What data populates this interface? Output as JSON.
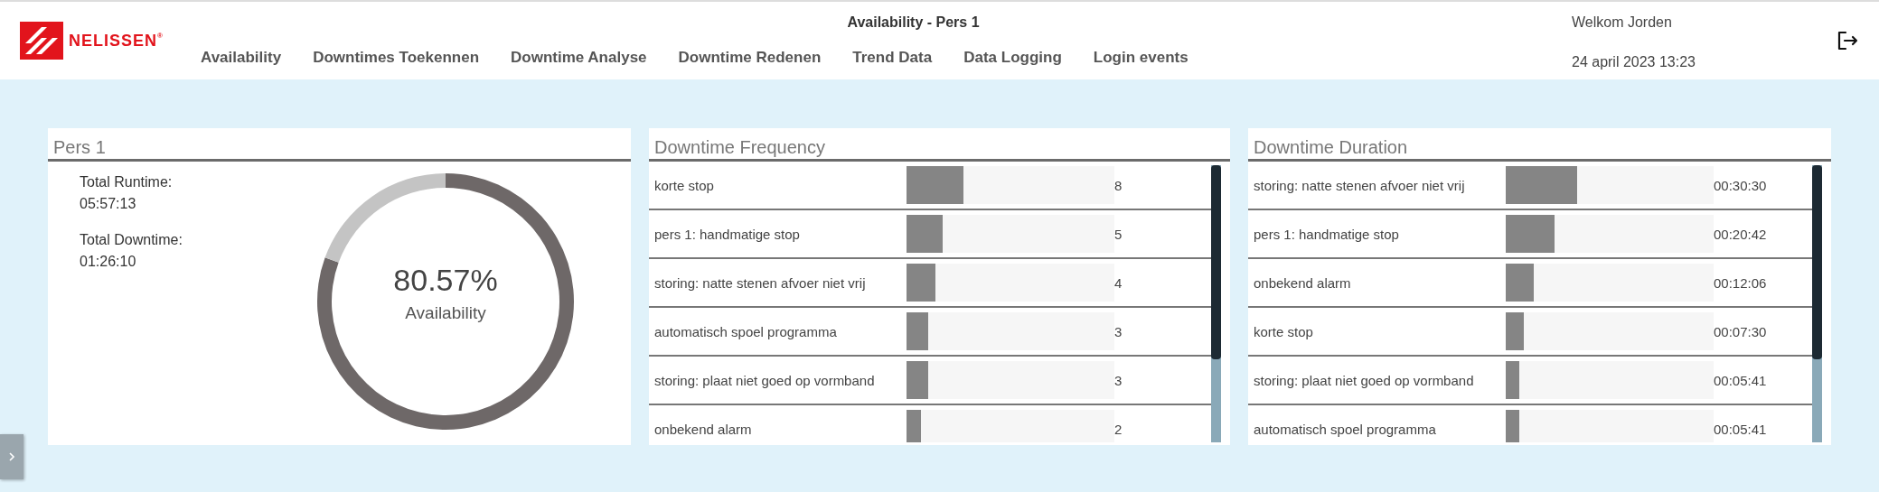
{
  "header": {
    "logo": {
      "text": "NELISSEN",
      "mark": "®"
    },
    "title": "Availability - Pers 1",
    "nav": [
      {
        "label": "Availability",
        "selected": false
      },
      {
        "label": "Downtimes Toekennen",
        "selected": false
      },
      {
        "label": "Downtime Analyse",
        "selected": false
      },
      {
        "label": "Downtime Redenen",
        "selected": false
      },
      {
        "label": "Trend Data",
        "selected": false
      },
      {
        "label": "Data Logging",
        "selected": false
      },
      {
        "label": "Login events",
        "selected": false
      }
    ],
    "welcome": "Welkom Jorden",
    "datetime": "24 april 2023 13:23"
  },
  "availability_panel": {
    "title": "Pers 1",
    "stats": [
      {
        "label": "Total Runtime:",
        "value": "05:57:13"
      },
      {
        "label": "Total Downtime:",
        "value": "01:26:10"
      }
    ],
    "gauge": {
      "value": "80.57%",
      "label": "Availability",
      "chart_data": {
        "type": "donut",
        "values": [
          80.57,
          19.43
        ]
      }
    }
  },
  "frequency_panel": {
    "title": "Downtime Frequency",
    "rows": [
      {
        "label": "korte stop",
        "level": 0.274,
        "value": "8"
      },
      {
        "label": "pers 1: handmatige stop",
        "level": 0.172,
        "value": "5"
      },
      {
        "label": "storing: natte stenen afvoer niet vrij",
        "level": 0.137,
        "value": "4"
      },
      {
        "label": "automatisch spoel programma",
        "level": 0.103,
        "value": "3"
      },
      {
        "label": "storing: plaat niet goed op vormband",
        "level": 0.103,
        "value": "3"
      },
      {
        "label": "onbekend alarm",
        "level": 0.069,
        "value": "2"
      }
    ]
  },
  "duration_panel": {
    "title": "Downtime Duration",
    "rows": [
      {
        "label": "storing: natte stenen afvoer niet vrij",
        "level": 0.343,
        "value": "00:30:30"
      },
      {
        "label": "pers 1: handmatige stop",
        "level": 0.233,
        "value": "00:20:42"
      },
      {
        "label": "onbekend alarm",
        "level": 0.136,
        "value": "00:12:06"
      },
      {
        "label": "korte stop",
        "level": 0.085,
        "value": "00:07:30"
      },
      {
        "label": "storing: plaat niet goed op vormband",
        "level": 0.064,
        "value": "00:05:41"
      },
      {
        "label": "automatisch spoel programma",
        "level": 0.064,
        "value": "00:05:41"
      }
    ]
  }
}
